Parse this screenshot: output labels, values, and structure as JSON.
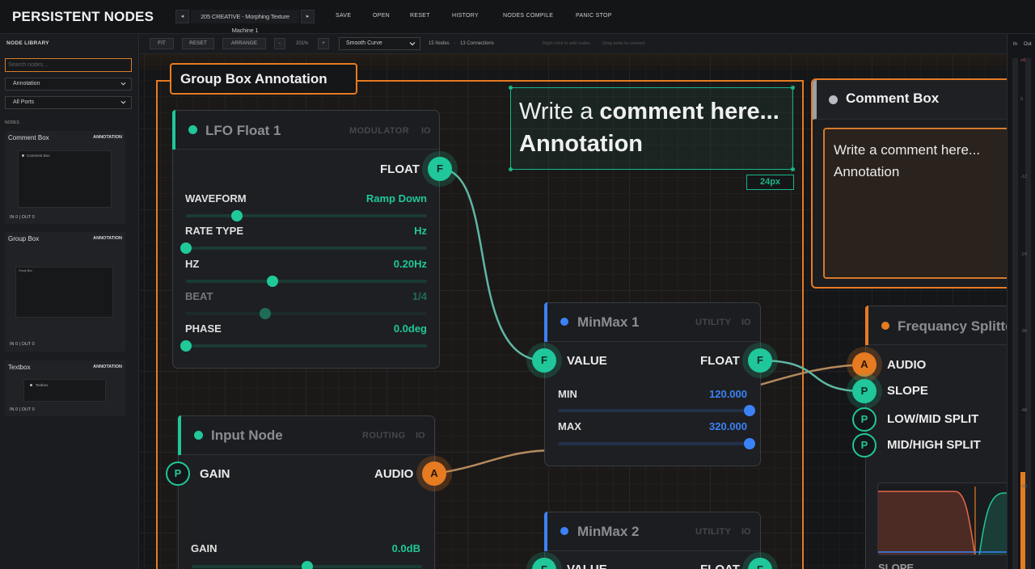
{
  "app": {
    "title": "PERSISTENT NODES"
  },
  "topbar": {
    "prev_icon": "◂",
    "next_icon": "▸",
    "preset_name": "205 CREATIVE - Morphing Texture Machine 1",
    "buttons": [
      "SAVE",
      "OPEN",
      "RESET",
      "HISTORY",
      "NODES COMPILE",
      "PANIC STOP"
    ]
  },
  "sidebar": {
    "title": "NODE LIBRARY",
    "search_placeholder": "Search nodes...",
    "category_filter": "Annotation",
    "port_filter": "All Ports",
    "section_label": "NODES",
    "cards": [
      {
        "name": "Comment Box",
        "category": "ANNOTATION",
        "io": "IN 0  |  OUT 0",
        "preview_text": "Comment Box"
      },
      {
        "name": "Group Box",
        "category": "ANNOTATION",
        "io": "IN 0  |  OUT 0",
        "preview_text": "Group Box"
      },
      {
        "name": "Textbox",
        "category": "ANNOTATION",
        "io": "IN 0  |  OUT 0",
        "preview_text": "Textbox"
      }
    ]
  },
  "toolbar": {
    "fit": "FIT",
    "reset": "RESET",
    "arrange": "ARRANGE",
    "zoom_out": "-",
    "zoom_level": "201%",
    "zoom_in": "+",
    "curve_style": "Smooth Curve",
    "node_count": "15 Nodes",
    "separator": "·",
    "connection_count": "13 Connections",
    "hint_add": "Right-click to add nodes",
    "hint_drag": "Drag ports to connect"
  },
  "canvas": {
    "group_box_label": "Group Box Annotation",
    "textbox": {
      "line1_regular": "Write a ",
      "line1_bold": "comment here...",
      "line2": "Annotation",
      "size_badge": "24px"
    },
    "comment_box": {
      "title": "Comment Box",
      "line1": "Write a comment here...",
      "line2": "Annotation"
    },
    "nodes": {
      "lfo": {
        "title": "LFO Float 1",
        "category": "MODULATOR",
        "io": "IO",
        "output_label": "FLOAT",
        "output_port": "F",
        "props": [
          {
            "label": "WAVEFORM",
            "value": "Ramp Down",
            "level": 0.21
          },
          {
            "label": "RATE TYPE",
            "value": "Hz",
            "level": 0.0
          },
          {
            "label": "HZ",
            "value": "0.20Hz",
            "level": 0.36
          },
          {
            "label": "BEAT",
            "value": "1/4",
            "level": 0.33
          },
          {
            "label": "PHASE",
            "value": "0.0deg",
            "level": 0.0
          }
        ]
      },
      "input": {
        "title": "Input Node",
        "category": "ROUTING",
        "io": "IO",
        "input_label": "GAIN",
        "input_port": "P",
        "output_label": "AUDIO",
        "output_port": "A",
        "gain_label": "GAIN",
        "gain_value": "0.0dB",
        "gain_level": 0.5
      },
      "minmax1": {
        "title": "MinMax 1",
        "category": "UTILITY",
        "io": "IO",
        "input_label": "VALUE",
        "input_port": "F",
        "output_label": "FLOAT",
        "output_port": "F",
        "min_label": "MIN",
        "min_value": "120.000",
        "min_level": 1.0,
        "max_label": "MAX",
        "max_value": "320.000",
        "max_level": 1.0
      },
      "minmax2": {
        "title": "MinMax 2",
        "category": "UTILITY",
        "io": "IO",
        "input_label": "VALUE",
        "input_port": "F",
        "output_label": "FLOAT",
        "output_port": "F"
      },
      "freq": {
        "title": "Frequancy Splitter",
        "ports": [
          {
            "port": "A",
            "label": "AUDIO"
          },
          {
            "port": "P",
            "label": "SLOPE"
          },
          {
            "port": "P",
            "label": "LOW/MID SPLIT"
          },
          {
            "port": "P",
            "label": "MID/HIGH SPLIT"
          }
        ],
        "slope_label": "SLOPE"
      }
    }
  },
  "meters": {
    "in_label": "In",
    "out_label": "Out",
    "ticks": [
      "+6",
      "0",
      "-12",
      "-24",
      "-36",
      "-48",
      "-60"
    ],
    "in_level": 0.0,
    "out_level": 0.19
  },
  "colors": {
    "accent_orange": "#e67b22",
    "accent_teal": "#1fc79a",
    "accent_blue": "#3b82f6",
    "comment_gray": "#b8bcc2"
  }
}
